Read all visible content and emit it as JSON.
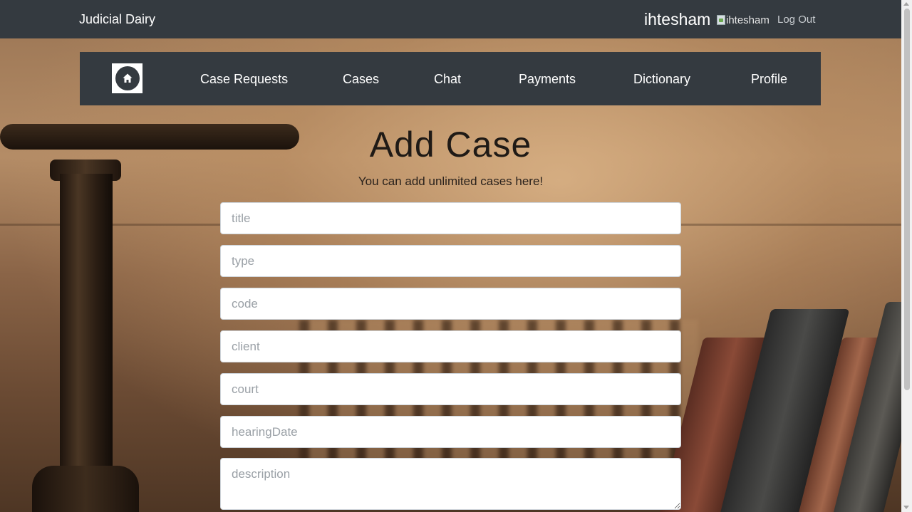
{
  "header": {
    "brand": "Judicial Dairy",
    "user_name": "ihtesham",
    "avatar_alt": "ihtesham",
    "logout_label": "Log Out"
  },
  "nav": {
    "home_icon": "home-icon",
    "items": [
      {
        "label": "Case Requests"
      },
      {
        "label": "Cases"
      },
      {
        "label": "Chat"
      },
      {
        "label": "Payments"
      },
      {
        "label": "Dictionary"
      },
      {
        "label": "Profile"
      }
    ]
  },
  "main": {
    "title": "Add Case",
    "subtitle": "You can add unlimited cases here!"
  },
  "form": {
    "fields": [
      {
        "placeholder": "title",
        "value": ""
      },
      {
        "placeholder": "type",
        "value": ""
      },
      {
        "placeholder": "code",
        "value": ""
      },
      {
        "placeholder": "client",
        "value": ""
      },
      {
        "placeholder": "court",
        "value": ""
      },
      {
        "placeholder": "hearingDate",
        "value": ""
      },
      {
        "placeholder": "description",
        "value": ""
      }
    ]
  },
  "colors": {
    "navbar": "#343a40",
    "text_on_dark": "#ffffff",
    "input_border": "#ced4da"
  }
}
